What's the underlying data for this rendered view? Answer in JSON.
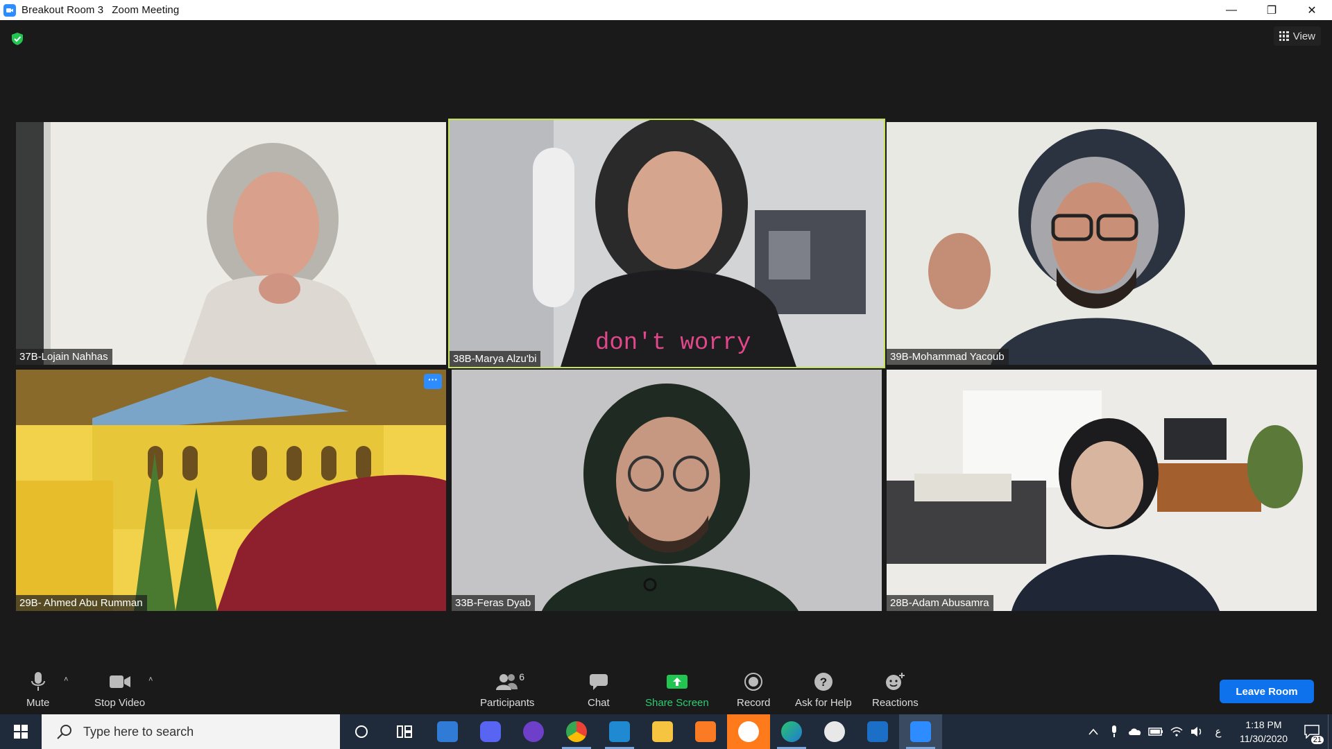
{
  "window": {
    "room_name": "Breakout Room 3",
    "app_title": "Zoom Meeting",
    "controls": [
      "—",
      "❐",
      "✕"
    ]
  },
  "top_bar": {
    "view_label": "View"
  },
  "participants": [
    {
      "name": "37B-Lojain Nahhas",
      "active_speaker": false
    },
    {
      "name": "38B-Marya Alzu'bi",
      "active_speaker": true
    },
    {
      "name": "39B-Mohammad Yacoub",
      "active_speaker": false
    },
    {
      "name": "29B- Ahmed Abu Rumman",
      "active_speaker": false
    },
    {
      "name": "33B-Feras Dyab",
      "active_speaker": false
    },
    {
      "name": "28B-Adam Abusamra",
      "active_speaker": false
    }
  ],
  "tile_menu": {
    "label": "···"
  },
  "toolbar": {
    "mute": "Mute",
    "stop_video": "Stop Video",
    "participants": "Participants",
    "participant_count": "6",
    "chat": "Chat",
    "share_screen": "Share Screen",
    "record": "Record",
    "ask_for_help": "Ask for Help",
    "reactions": "Reactions",
    "leave_room": "Leave Room",
    "caret": "˄"
  },
  "taskbar": {
    "search_placeholder": "Type here to search",
    "time": "1:18 PM",
    "date": "11/30/2020",
    "notification_count": "21",
    "input_language": "ع"
  },
  "colors": {
    "active_speaker_border": "#c5e35a",
    "share_green": "#2ecc71",
    "leave_blue": "#0e72ed",
    "zoom_blue": "#2d8cff"
  }
}
